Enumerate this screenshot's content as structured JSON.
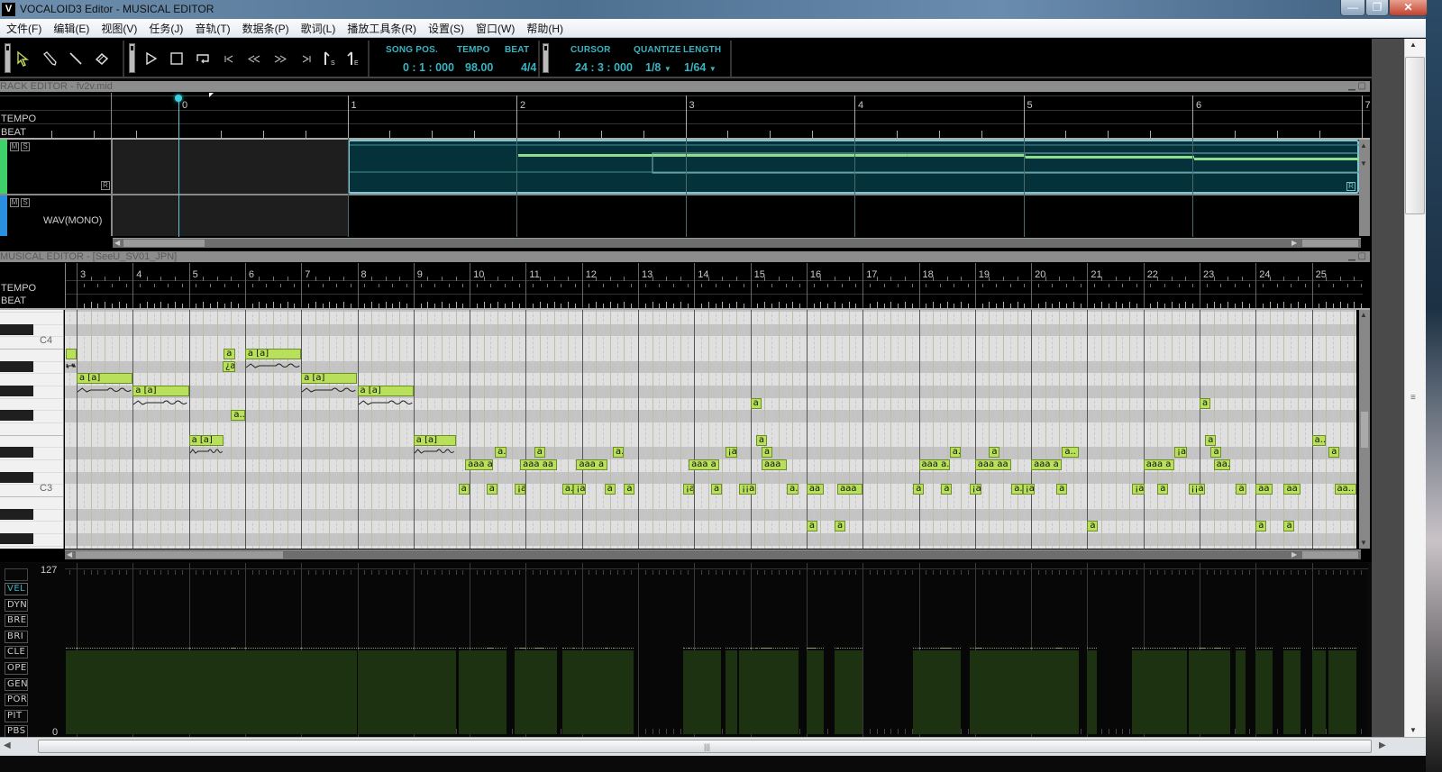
{
  "window": {
    "app_icon": "V",
    "title": "VOCALOID3 Editor - MUSICAL EDITOR",
    "controls": {
      "minimize": "—",
      "maximize": "❐",
      "close": "✕"
    }
  },
  "menu": [
    "文件(F)",
    "编辑(E)",
    "视图(V)",
    "任务(J)",
    "音轨(T)",
    "数据条(P)",
    "歌词(L)",
    "播放工具条(R)",
    "设置(S)",
    "窗口(W)",
    "帮助(H)"
  ],
  "toolbar": {
    "edit_tools": [
      {
        "name": "arrow-tool",
        "icon": "arrow-icon"
      },
      {
        "name": "pencil-tool",
        "icon": "pencil-icon"
      },
      {
        "name": "line-tool",
        "icon": "line-icon"
      },
      {
        "name": "eraser-tool",
        "icon": "eraser-icon"
      }
    ],
    "transport": [
      {
        "name": "play",
        "icon": "play-icon"
      },
      {
        "name": "stop",
        "icon": "stop-icon"
      },
      {
        "name": "loop",
        "icon": "loop-icon"
      },
      {
        "name": "go-to-start",
        "icon": "skip-start-icon"
      },
      {
        "name": "rewind",
        "icon": "rewind-icon"
      },
      {
        "name": "fast-forward",
        "icon": "fast-forward-icon"
      },
      {
        "name": "go-to-end",
        "icon": "skip-end-icon"
      },
      {
        "name": "start-marker",
        "icon": "start-marker-icon"
      },
      {
        "name": "end-marker",
        "icon": "end-marker-icon"
      }
    ],
    "song_pos_label": "SONG POS.",
    "song_pos": "0 : 1 : 000",
    "tempo_label": "TEMPO",
    "tempo": "98.00",
    "beat_label": "BEAT",
    "beat": "4/4",
    "cursor_label": "CURSOR",
    "cursor": "24 : 3 : 000",
    "quantize_label": "QUANTIZE",
    "quantize": "1/8",
    "length_label": "LENGTH",
    "length": "1/64"
  },
  "track_editor": {
    "title": "RACK EDITOR - fv2v.mid",
    "ruler_labels": [
      "TEMPO",
      "BEAT"
    ],
    "measures": [
      "0",
      "1",
      "2",
      "3",
      "4",
      "5",
      "6",
      "7"
    ],
    "tracks": [
      {
        "mute": "M",
        "solo": "S",
        "render": "R",
        "color": "#3fd06a",
        "name": ""
      },
      {
        "mute": "M",
        "solo": "S",
        "color": "#2a8fe0",
        "name": "WAV(MONO)"
      }
    ],
    "part_start_measure": 1
  },
  "musical_editor": {
    "title": "MUSICAL EDITOR - [SeeU_SV01_JPN]",
    "ruler_labels": [
      "TEMPO",
      "BEAT"
    ],
    "measures": [
      "3",
      "4",
      "5",
      "6",
      "7",
      "8",
      "9",
      "10",
      "11",
      "12",
      "13",
      "14",
      "15",
      "16",
      "17",
      "18",
      "19",
      "20",
      "21",
      "22",
      "23",
      "24",
      "25"
    ],
    "key_labels": {
      "C4": "C4",
      "C3": "C3"
    },
    "notes": [
      {
        "m": 2.8,
        "len": 0.2,
        "p": 71,
        "lyric": "",
        "vib": true
      },
      {
        "m": 3.0,
        "len": 1.0,
        "p": 69,
        "lyric": "a [a]",
        "vib": true
      },
      {
        "m": 4.0,
        "len": 1.0,
        "p": 68,
        "lyric": "a [a]",
        "vib": true
      },
      {
        "m": 5.0,
        "len": 0.62,
        "p": 64,
        "lyric": "a [a]",
        "vib": true
      },
      {
        "m": 5.75,
        "len": 0.25,
        "p": 66,
        "lyric": "a.."
      },
      {
        "m": 5.62,
        "len": 0.2,
        "p": 71,
        "lyric": "a"
      },
      {
        "m": 5.6,
        "len": 0.22,
        "p": 70,
        "lyric": "¿a"
      },
      {
        "m": 6.0,
        "len": 1.0,
        "p": 71,
        "lyric": "a [a]",
        "vib": true
      },
      {
        "m": 7.0,
        "len": 1.0,
        "p": 69,
        "lyric": "a [a]",
        "vib": true
      },
      {
        "m": 8.0,
        "len": 1.0,
        "p": 68,
        "lyric": "a [a]",
        "vib": true
      },
      {
        "m": 9.0,
        "len": 0.75,
        "p": 64,
        "lyric": "a [a]",
        "vib": true
      },
      {
        "m": 9.8,
        "len": 0.17,
        "p": 60,
        "lyric": "a"
      },
      {
        "m": 9.92,
        "len": 0.5,
        "p": 62,
        "lyric": "aaa a."
      },
      {
        "m": 10.45,
        "len": 0.2,
        "p": 63,
        "lyric": "a."
      },
      {
        "m": 10.3,
        "len": 0.17,
        "p": 60,
        "lyric": "a"
      },
      {
        "m": 10.8,
        "len": 0.2,
        "p": 60,
        "lyric": "¡a"
      },
      {
        "m": 10.9,
        "len": 0.65,
        "p": 62,
        "lyric": "aaa aa"
      },
      {
        "m": 11.15,
        "len": 0.17,
        "p": 63,
        "lyric": "a"
      },
      {
        "m": 11.65,
        "len": 0.2,
        "p": 60,
        "lyric": "a."
      },
      {
        "m": 11.85,
        "len": 0.22,
        "p": 60,
        "lyric": "¡a"
      },
      {
        "m": 11.9,
        "len": 0.55,
        "p": 62,
        "lyric": "aaa a"
      },
      {
        "m": 12.4,
        "len": 0.17,
        "p": 60,
        "lyric": "a"
      },
      {
        "m": 12.55,
        "len": 0.2,
        "p": 63,
        "lyric": "a."
      },
      {
        "m": 12.75,
        "len": 0.17,
        "p": 60,
        "lyric": "a"
      },
      {
        "m": 13.8,
        "len": 0.2,
        "p": 60,
        "lyric": "¡a"
      },
      {
        "m": 13.9,
        "len": 0.55,
        "p": 62,
        "lyric": "aaa a"
      },
      {
        "m": 14.3,
        "len": 0.17,
        "p": 60,
        "lyric": "a"
      },
      {
        "m": 14.55,
        "len": 0.22,
        "p": 63,
        "lyric": "¡a"
      },
      {
        "m": 14.8,
        "len": 0.3,
        "p": 60,
        "lyric": "¡¡a"
      },
      {
        "m": 15.0,
        "len": 0.17,
        "p": 67,
        "lyric": "a"
      },
      {
        "m": 15.1,
        "len": 0.17,
        "p": 64,
        "lyric": "a"
      },
      {
        "m": 15.2,
        "len": 0.17,
        "p": 63,
        "lyric": "a"
      },
      {
        "m": 15.2,
        "len": 0.45,
        "p": 62,
        "lyric": "aaa"
      },
      {
        "m": 15.65,
        "len": 0.2,
        "p": 60,
        "lyric": "a."
      },
      {
        "m": 16.0,
        "len": 0.3,
        "p": 60,
        "lyric": "aa"
      },
      {
        "m": 16.0,
        "len": 0.17,
        "p": 57,
        "lyric": "a"
      },
      {
        "m": 16.5,
        "len": 0.17,
        "p": 57,
        "lyric": "a"
      },
      {
        "m": 16.55,
        "len": 0.45,
        "p": 60,
        "lyric": "aaa"
      },
      {
        "m": 17.9,
        "len": 0.17,
        "p": 60,
        "lyric": "a"
      },
      {
        "m": 18.0,
        "len": 0.55,
        "p": 62,
        "lyric": "aaa a."
      },
      {
        "m": 18.4,
        "len": 0.17,
        "p": 60,
        "lyric": "a"
      },
      {
        "m": 18.55,
        "len": 0.2,
        "p": 63,
        "lyric": "a."
      },
      {
        "m": 18.9,
        "len": 0.22,
        "p": 60,
        "lyric": "¡a"
      },
      {
        "m": 19.0,
        "len": 0.65,
        "p": 62,
        "lyric": "aaa aa"
      },
      {
        "m": 19.25,
        "len": 0.17,
        "p": 63,
        "lyric": "a"
      },
      {
        "m": 19.65,
        "len": 0.2,
        "p": 60,
        "lyric": "a."
      },
      {
        "m": 19.85,
        "len": 0.22,
        "p": 60,
        "lyric": "¡a"
      },
      {
        "m": 20.0,
        "len": 0.55,
        "p": 62,
        "lyric": "aaa a"
      },
      {
        "m": 20.45,
        "len": 0.17,
        "p": 60,
        "lyric": "a"
      },
      {
        "m": 20.55,
        "len": 0.3,
        "p": 63,
        "lyric": "a.."
      },
      {
        "m": 21.0,
        "len": 0.17,
        "p": 57,
        "lyric": "a"
      },
      {
        "m": 21.8,
        "len": 0.22,
        "p": 60,
        "lyric": "¡a"
      },
      {
        "m": 22.0,
        "len": 0.55,
        "p": 62,
        "lyric": "aaa a"
      },
      {
        "m": 22.25,
        "len": 0.17,
        "p": 60,
        "lyric": "a"
      },
      {
        "m": 22.55,
        "len": 0.22,
        "p": 63,
        "lyric": "¡a"
      },
      {
        "m": 22.8,
        "len": 0.3,
        "p": 60,
        "lyric": "¡¡a"
      },
      {
        "m": 23.0,
        "len": 0.17,
        "p": 67,
        "lyric": "a"
      },
      {
        "m": 23.1,
        "len": 0.17,
        "p": 64,
        "lyric": "a"
      },
      {
        "m": 23.2,
        "len": 0.17,
        "p": 63,
        "lyric": "a"
      },
      {
        "m": 23.25,
        "len": 0.3,
        "p": 62,
        "lyric": "aa."
      },
      {
        "m": 23.65,
        "len": 0.17,
        "p": 60,
        "lyric": "a"
      },
      {
        "m": 24.0,
        "len": 0.3,
        "p": 60,
        "lyric": "aa"
      },
      {
        "m": 24.0,
        "len": 0.17,
        "p": 57,
        "lyric": "a"
      },
      {
        "m": 24.5,
        "len": 0.17,
        "p": 57,
        "lyric": "a"
      },
      {
        "m": 24.5,
        "len": 0.3,
        "p": 60,
        "lyric": "aa"
      },
      {
        "m": 25.0,
        "len": 0.25,
        "p": 64,
        "lyric": "a.."
      },
      {
        "m": 25.3,
        "len": 0.17,
        "p": 63,
        "lyric": "a"
      },
      {
        "m": 25.4,
        "len": 0.4,
        "p": 60,
        "lyric": "aa.."
      }
    ]
  },
  "control_track": {
    "max_label": "127",
    "min_label": "0",
    "buttons": [
      "VEL",
      "DYN",
      "BRE",
      "BRI",
      "CLE",
      "OPE",
      "GEN",
      "POR",
      "PIT",
      "PBS"
    ],
    "active": "VEL",
    "velocity_value": 64
  },
  "colors": {
    "accent_cyan": "#3ab3c0",
    "note_fill": "#b8e05a",
    "part_fill": "#05313a",
    "velocity_fill": "#1d3210"
  }
}
